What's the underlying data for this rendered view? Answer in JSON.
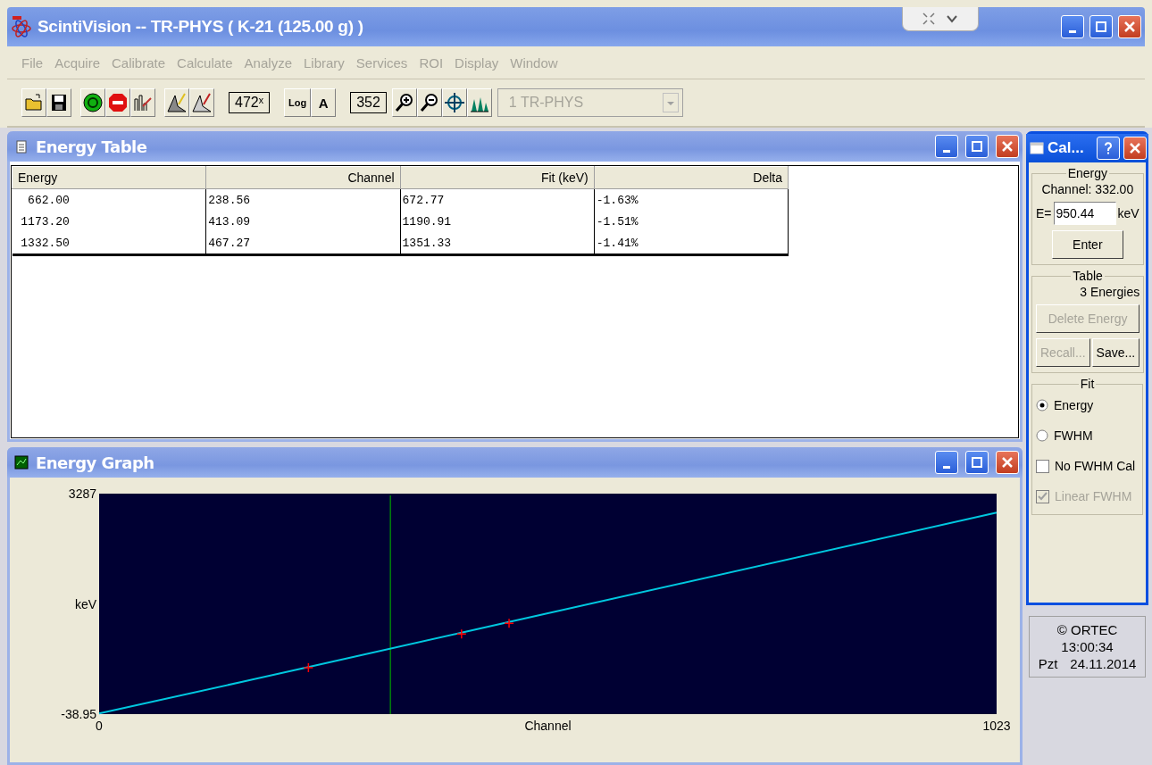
{
  "window": {
    "title": "ScintiVision -- TR-PHYS ( K-21 (125.00 g) )"
  },
  "menu": [
    {
      "label": "File",
      "disabled": true
    },
    {
      "label": "Acquire",
      "disabled": true
    },
    {
      "label": "Calibrate",
      "disabled": true
    },
    {
      "label": "Calculate",
      "disabled": true
    },
    {
      "label": "Analyze",
      "disabled": true
    },
    {
      "label": "Library",
      "disabled": true
    },
    {
      "label": "Services",
      "disabled": true
    },
    {
      "label": "ROI",
      "disabled": true
    },
    {
      "label": "Display",
      "disabled": true
    },
    {
      "label": "Window",
      "disabled": true
    }
  ],
  "toolbar": {
    "horizontal_scale": "472ˣ",
    "log_button": "Log",
    "auto_button": "A",
    "vertical_scale": "352",
    "spectrum_select": {
      "value": "1 TR-PHYS",
      "disabled": true
    }
  },
  "energy_table": {
    "title": "Energy Table",
    "columns": [
      "Energy",
      "Channel",
      "Fit (keV)",
      "Delta"
    ],
    "rows": [
      [
        "662.00",
        "238.56",
        "672.77",
        "-1.63%"
      ],
      [
        "1173.20",
        "413.09",
        "1190.91",
        "-1.51%"
      ],
      [
        "1332.50",
        "467.27",
        "1351.33",
        "-1.41%"
      ]
    ]
  },
  "energy_graph": {
    "title": "Energy Graph",
    "chart_data": {
      "type": "line",
      "xlabel": "Channel",
      "ylabel": "keV",
      "xlim": [
        0,
        1023
      ],
      "ylim": [
        -38.95,
        3287
      ],
      "xticks": [
        0,
        1023
      ],
      "yticks": [
        -38.95,
        3287
      ],
      "x": [
        0,
        238.56,
        413.09,
        467.27,
        1023
      ],
      "series": [
        {
          "color": "#00c8e0",
          "values": [
            -30,
            670,
            1190,
            1350,
            3000
          ]
        },
        {
          "color": "#ff0000",
          "values": [
            null,
            660,
            1170,
            1330,
            null
          ]
        }
      ],
      "ref_lines": [
        {
          "axis": "x",
          "value": 332,
          "color": "#00a000"
        }
      ]
    }
  },
  "calibration_dialog": {
    "title": "Cal...",
    "energy_group": {
      "legend": "Energy",
      "channel": "Channel: 332.00",
      "e_label": "E=",
      "e_value": "950.44",
      "unit": "keV",
      "enter_button": "Enter"
    },
    "table_group": {
      "legend": "Table",
      "count": "3 Energies",
      "buttons": [
        {
          "label": "Delete Energy",
          "disabled": true
        },
        {
          "label": "Recall...",
          "disabled": true
        },
        {
          "label": "Save...",
          "disabled": false
        }
      ]
    },
    "fit_group": {
      "legend": "Fit",
      "options": [
        {
          "kind": "radio",
          "label": "Energy",
          "selected": true,
          "disabled": false
        },
        {
          "kind": "radio",
          "label": "FWHM",
          "selected": false,
          "disabled": false
        },
        {
          "kind": "checkbox",
          "label": "No FWHM Cal",
          "checked": false,
          "disabled": false
        },
        {
          "kind": "checkbox",
          "label": "Linear FWHM",
          "checked": true,
          "disabled": true
        }
      ]
    }
  },
  "clock": {
    "copyright": "© ORTEC",
    "time": "13:00:34",
    "day": "Pzt",
    "date": "24.11.2014"
  }
}
